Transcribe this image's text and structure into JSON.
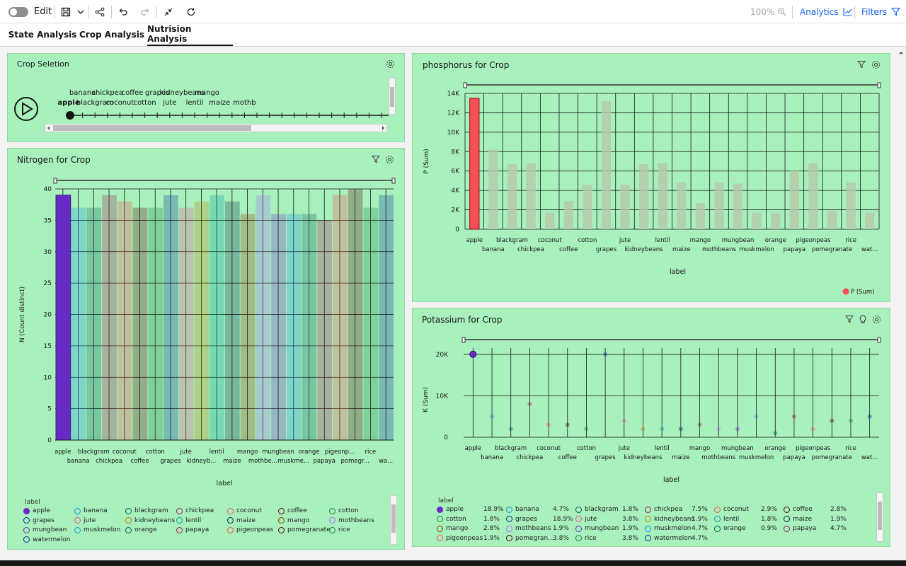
{
  "toolbar": {
    "edit_label": "Edit",
    "zoom": "100%",
    "analytics_label": "Analytics",
    "filters_label": "Filters"
  },
  "tabs": [
    {
      "label": "State Analysis",
      "active": false
    },
    {
      "label": "Crop Analysis",
      "active": false
    },
    {
      "label": "Nutrision Analysis",
      "active": true
    }
  ],
  "crop_selection": {
    "title": "Crop Seletion",
    "selected": "apple",
    "upper_labels": [
      "banana",
      "chickpea",
      "coffee",
      "grapes",
      "kidneybeans",
      "mango"
    ],
    "lower_labels": [
      "apple",
      "blackgram",
      "coconut",
      "cotton",
      "jute",
      "lentil",
      "maize",
      "mothb"
    ]
  },
  "nitrogen": {
    "title": "Nitrogen for Crop",
    "ylabel": "N (Count distinct)",
    "xlabel": "label",
    "ticks_upper": [
      "apple",
      "blackgram",
      "coconut",
      "cotton",
      "jute",
      "lentil",
      "mango",
      "mungbean",
      "orange",
      "pigeonp...",
      "rice"
    ],
    "ticks_lower": [
      "banana",
      "chickpea",
      "coffee",
      "grapes",
      "kidneyb...",
      "maize",
      "mothbe...",
      "muskme...",
      "papaya",
      "pomegr...",
      "wa..."
    ]
  },
  "phosphorus": {
    "title": "phosphorus for Crop",
    "ylabel": "P (Sum)",
    "xlabel": "label",
    "legend": "P (Sum)",
    "ticks_upper": [
      "apple",
      "blackgram",
      "coconut",
      "cotton",
      "jute",
      "lentil",
      "mango",
      "mungbean",
      "orange",
      "pigeonpeas",
      "rice"
    ],
    "ticks_lower": [
      "banana",
      "chickpea",
      "coffee",
      "grapes",
      "kidneybeans",
      "maize",
      "mothbeans",
      "muskmelon",
      "papaya",
      "pomegranate",
      "wat..."
    ]
  },
  "potassium": {
    "title": "Potassium for Crop",
    "ylabel": "K (Sum)",
    "xlabel": "label",
    "ticks_upper": [
      "apple",
      "blackgram",
      "coconut",
      "cotton",
      "jute",
      "lentil",
      "mango",
      "mungbean",
      "orange",
      "pigeonpeas",
      "rice"
    ],
    "ticks_lower": [
      "banana",
      "chickpea",
      "coffee",
      "grapes",
      "kidneybeans",
      "maize",
      "mothbeans",
      "muskmelon",
      "papaya",
      "pomegranate",
      "wat..."
    ]
  },
  "nitrogen_legend": {
    "title": "label",
    "items": [
      {
        "label": "apple",
        "color": "#6929c4"
      },
      {
        "label": "banana",
        "color": "#1192e8"
      },
      {
        "label": "blackgram",
        "color": "#005d5d"
      },
      {
        "label": "chickpea",
        "color": "#9f1853"
      },
      {
        "label": "coconut",
        "color": "#fa4d56"
      },
      {
        "label": "coffee",
        "color": "#570408"
      },
      {
        "label": "cotton",
        "color": "#198038"
      },
      {
        "label": "grapes",
        "color": "#002d9c"
      },
      {
        "label": "jute",
        "color": "#ee538b"
      },
      {
        "label": "kidneybeans",
        "color": "#b28600"
      },
      {
        "label": "lentil",
        "color": "#009d9a"
      },
      {
        "label": "maize",
        "color": "#012749"
      },
      {
        "label": "mango",
        "color": "#8a3800"
      },
      {
        "label": "mothbeans",
        "color": "#a56eff"
      },
      {
        "label": "mungbean",
        "color": "#6929c4"
      },
      {
        "label": "muskmelon",
        "color": "#1192e8"
      },
      {
        "label": "orange",
        "color": "#005d5d"
      },
      {
        "label": "papaya",
        "color": "#9f1853"
      },
      {
        "label": "pigeonpeas",
        "color": "#fa4d56"
      },
      {
        "label": "pomegranate",
        "color": "#570408"
      },
      {
        "label": "rice",
        "color": "#198038"
      },
      {
        "label": "watermelon",
        "color": "#002d9c"
      }
    ]
  },
  "potassium_legend": {
    "title": "label",
    "items": [
      {
        "label": "apple",
        "pct": "18.9%",
        "color": "#6929c4"
      },
      {
        "label": "banana",
        "pct": "4.7%",
        "color": "#1192e8"
      },
      {
        "label": "blackgram",
        "pct": "1.8%",
        "color": "#005d5d"
      },
      {
        "label": "chickpea",
        "pct": "7.5%",
        "color": "#9f1853"
      },
      {
        "label": "coconut",
        "pct": "2.9%",
        "color": "#fa4d56"
      },
      {
        "label": "coffee",
        "pct": "2.8%",
        "color": "#570408"
      },
      {
        "label": "cotton",
        "pct": "1.8%",
        "color": "#198038"
      },
      {
        "label": "grapes",
        "pct": "18.9%",
        "color": "#002d9c"
      },
      {
        "label": "jute",
        "pct": "3.8%",
        "color": "#ee538b"
      },
      {
        "label": "kidneybeans",
        "pct": "1.9%",
        "color": "#b28600"
      },
      {
        "label": "lentil",
        "pct": "1.8%",
        "color": "#009d9a"
      },
      {
        "label": "maize",
        "pct": "1.9%",
        "color": "#012749"
      },
      {
        "label": "mango",
        "pct": "2.8%",
        "color": "#8a3800"
      },
      {
        "label": "mothbeans",
        "pct": "1.9%",
        "color": "#a56eff"
      },
      {
        "label": "mungbean",
        "pct": "1.9%",
        "color": "#6929c4"
      },
      {
        "label": "muskmelon",
        "pct": "4.7%",
        "color": "#1192e8"
      },
      {
        "label": "orange",
        "pct": "0.9%",
        "color": "#005d5d"
      },
      {
        "label": "papaya",
        "pct": "4.7%",
        "color": "#9f1853"
      },
      {
        "label": "pigeonpeas",
        "pct": "1.9%",
        "color": "#fa4d56"
      },
      {
        "label": "pomegran...",
        "pct": "3.8%",
        "color": "#570408"
      },
      {
        "label": "rice",
        "pct": "3.8%",
        "color": "#198038"
      },
      {
        "label": "watermelon",
        "pct": "4.7%",
        "color": "#002d9c"
      }
    ]
  },
  "chart_data": [
    {
      "type": "bar",
      "title": "Nitrogen for Crop",
      "xlabel": "label",
      "ylabel": "N (Count distinct)",
      "ylim": [
        0,
        40
      ],
      "yticks": [
        0,
        5,
        10,
        15,
        20,
        25,
        30,
        35,
        40
      ],
      "categories": [
        "apple",
        "banana",
        "blackgram",
        "chickpea",
        "coconut",
        "coffee",
        "cotton",
        "grapes",
        "jute",
        "kidneybeans",
        "lentil",
        "maize",
        "mango",
        "mothbeans",
        "mungbean",
        "muskmelon",
        "orange",
        "papaya",
        "pigeonpeas",
        "pomegranate",
        "rice",
        "watermelon"
      ],
      "values": [
        39,
        37,
        37,
        39,
        38,
        37,
        37,
        39,
        37,
        38,
        39,
        38,
        36,
        39,
        36,
        36,
        36,
        35,
        39,
        40,
        37,
        39
      ],
      "highlight": "apple",
      "grid": true
    },
    {
      "type": "bar",
      "title": "phosphorus for Crop",
      "xlabel": "label",
      "ylabel": "P (Sum)",
      "ylim": [
        0,
        14000
      ],
      "yticks": [
        "0",
        "2K",
        "4K",
        "6K",
        "8K",
        "10K",
        "12K",
        "14K"
      ],
      "categories": [
        "apple",
        "banana",
        "blackgram",
        "chickpea",
        "coconut",
        "coffee",
        "cotton",
        "grapes",
        "jute",
        "kidneybeans",
        "lentil",
        "maize",
        "mango",
        "mothbeans",
        "mungbean",
        "muskmelon",
        "orange",
        "papaya",
        "pigeonpeas",
        "pomegranate",
        "rice",
        "watermelon"
      ],
      "series": [
        {
          "name": "P (Sum)",
          "values": [
            13500,
            8200,
            6700,
            6800,
            1700,
            2900,
            4600,
            13200,
            4600,
            6700,
            6800,
            4800,
            2700,
            4800,
            4700,
            1700,
            1700,
            6000,
            6800,
            1900,
            4800,
            1700
          ]
        }
      ],
      "highlight": "apple",
      "legend_position": "bottom-right",
      "grid": true
    },
    {
      "type": "scatter",
      "title": "Potassium for Crop",
      "xlabel": "label",
      "ylabel": "K (Sum)",
      "ylim": [
        0,
        20000
      ],
      "yticks": [
        "0",
        "10K",
        "20K"
      ],
      "categories": [
        "apple",
        "banana",
        "blackgram",
        "chickpea",
        "coconut",
        "coffee",
        "cotton",
        "grapes",
        "jute",
        "kidneybeans",
        "lentil",
        "maize",
        "mango",
        "mothbeans",
        "mungbean",
        "muskmelon",
        "orange",
        "papaya",
        "pigeonpeas",
        "pomegranate",
        "rice",
        "watermelon"
      ],
      "values": [
        20000,
        5000,
        2000,
        8000,
        3000,
        3000,
        2000,
        20000,
        4000,
        2000,
        2000,
        2000,
        3000,
        2000,
        2000,
        5000,
        1000,
        5000,
        2000,
        4000,
        4000,
        5000
      ],
      "highlight": "apple",
      "grid": true
    }
  ]
}
